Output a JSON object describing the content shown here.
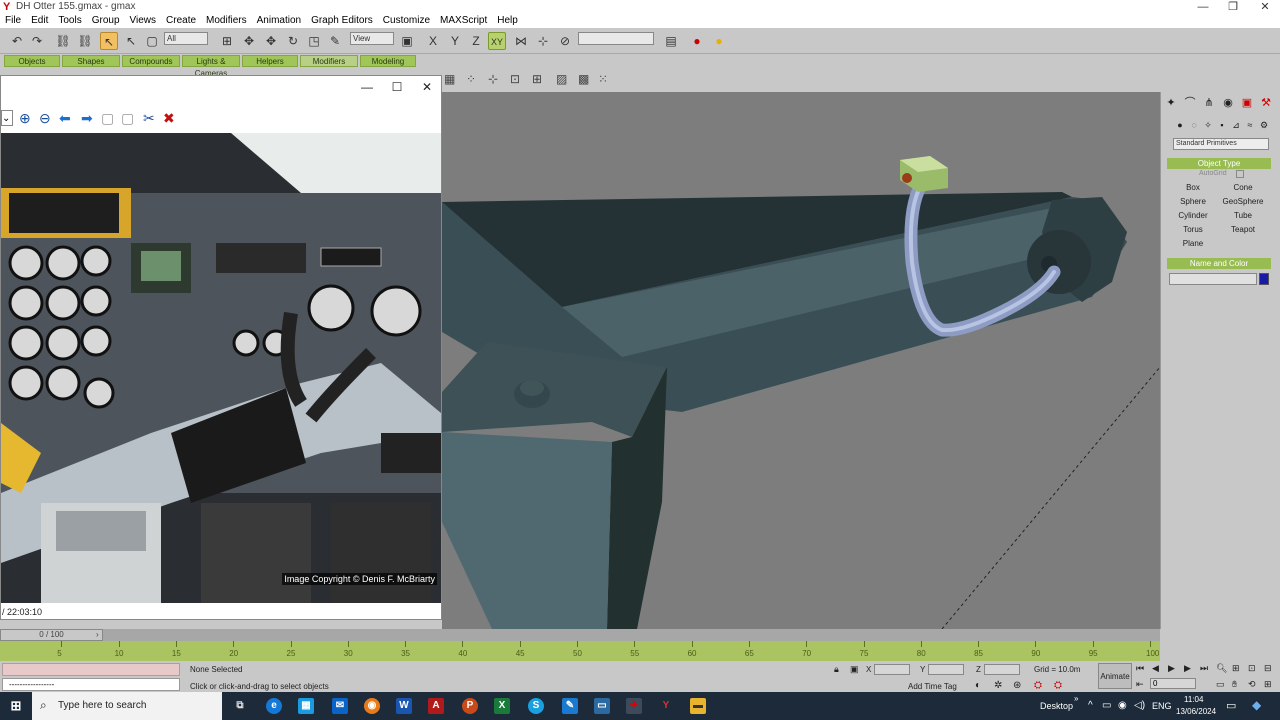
{
  "window": {
    "title": "DH Otter 155.gmax - gmax"
  },
  "menu": [
    "File",
    "Edit",
    "Tools",
    "Group",
    "Views",
    "Create",
    "Modifiers",
    "Animation",
    "Graph Editors",
    "Customize",
    "MAXScript",
    "Help"
  ],
  "toolbar": {
    "selection_filter": "All",
    "reference_coord": "View",
    "named_selection": ""
  },
  "tabs": [
    "Objects",
    "Shapes",
    "Compounds",
    "Lights & Cameras",
    "Helpers",
    "Modifiers",
    "Modeling"
  ],
  "image_window": {
    "copyright": "Image Copyright © Denis F. McBriarty",
    "time": "/ 22:03:10"
  },
  "command_panel": {
    "category": "Standard Primitives",
    "object_type_header": "Object Type",
    "autogrid": "AutoGrid",
    "buttons": [
      "Box",
      "Cone",
      "Sphere",
      "GeoSphere",
      "Cylinder",
      "Tube",
      "Torus",
      "Teapot",
      "Plane"
    ],
    "name_color_header": "Name and Color",
    "swatch_color": "#1a1aa8"
  },
  "timeline": {
    "slider": "0 / 100",
    "ticks": [
      "5",
      "10",
      "15",
      "20",
      "25",
      "30",
      "35",
      "40",
      "45",
      "50",
      "55",
      "60",
      "65",
      "70",
      "75",
      "80",
      "85",
      "90",
      "95",
      "100"
    ]
  },
  "status": {
    "selection": "None Selected",
    "prompt": "Click or click-and-drag to select objects",
    "listener": "-----------------",
    "x_label": "X",
    "y_label": "Y",
    "z_label": "Z",
    "grid": "Grid = 10.0m",
    "add_time_tag": "Add Time Tag",
    "animate": "Animate",
    "frame": "0"
  },
  "taskbar": {
    "search_placeholder": "Type here to search",
    "desktop": "Desktop",
    "lang": "ENG",
    "time": "11:04",
    "date": "13/06/2024"
  }
}
